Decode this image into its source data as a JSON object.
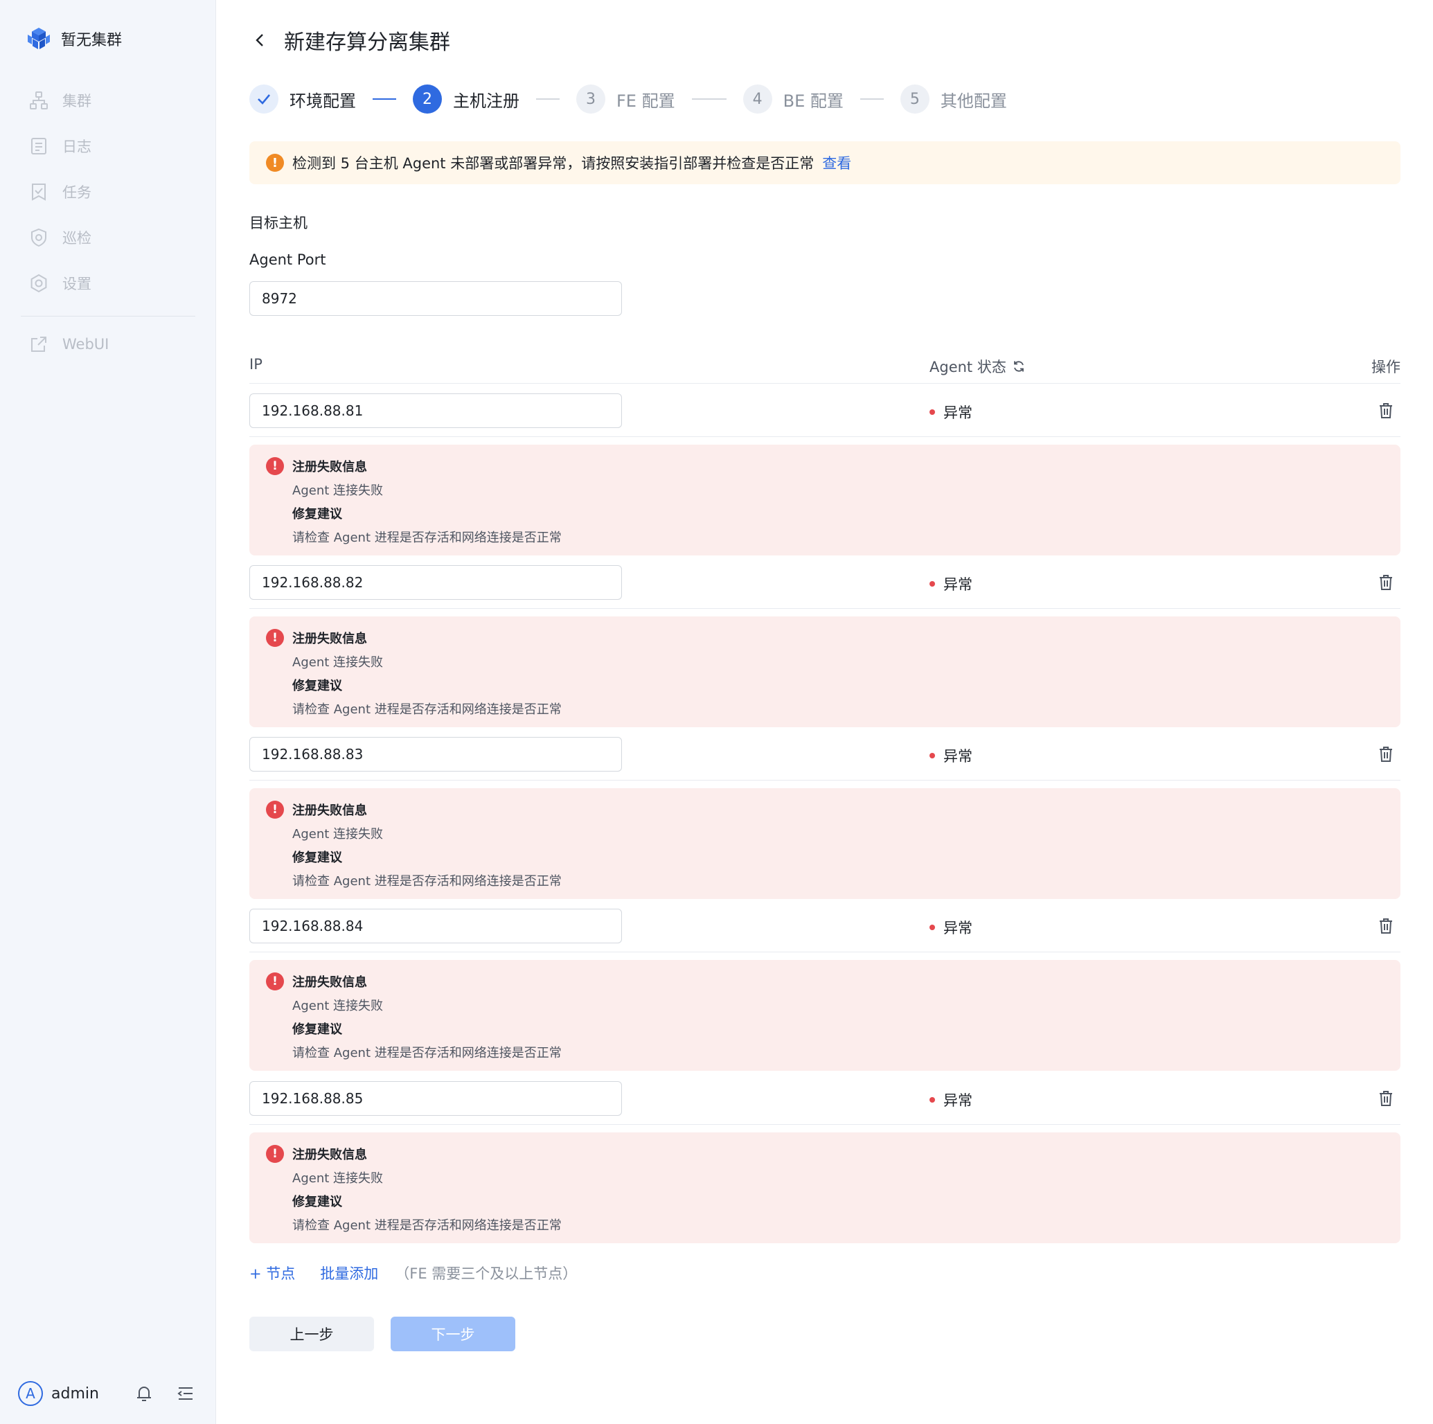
{
  "sidebar": {
    "brand": "暂无集群",
    "items": [
      {
        "label": "集群",
        "icon": "cluster-icon"
      },
      {
        "label": "日志",
        "icon": "log-icon"
      },
      {
        "label": "任务",
        "icon": "task-icon"
      },
      {
        "label": "巡检",
        "icon": "inspect-icon"
      },
      {
        "label": "设置",
        "icon": "settings-icon"
      }
    ],
    "webui": {
      "label": "WebUI",
      "icon": "external-link-icon"
    },
    "user": {
      "avatar_letter": "A",
      "name": "admin"
    }
  },
  "header": {
    "title": "新建存算分离集群"
  },
  "steps": [
    {
      "number": "",
      "label": "环境配置",
      "state": "done"
    },
    {
      "number": "2",
      "label": "主机注册",
      "state": "active"
    },
    {
      "number": "3",
      "label": "FE 配置",
      "state": "todo"
    },
    {
      "number": "4",
      "label": "BE 配置",
      "state": "todo"
    },
    {
      "number": "5",
      "label": "其他配置",
      "state": "todo"
    }
  ],
  "alert": {
    "icon": "!",
    "text": "检测到 5 台主机 Agent 未部署或部署异常，请按照安装指引部署并检查是否正常",
    "link": "查看"
  },
  "form": {
    "section_label": "目标主机",
    "port_label": "Agent Port",
    "port_value": "8972"
  },
  "table": {
    "col_ip": "IP",
    "col_status": "Agent 状态",
    "col_op": "操作",
    "rows": [
      {
        "ip": "192.168.88.81",
        "status": "异常"
      },
      {
        "ip": "192.168.88.82",
        "status": "异常"
      },
      {
        "ip": "192.168.88.83",
        "status": "异常"
      },
      {
        "ip": "192.168.88.84",
        "status": "异常"
      },
      {
        "ip": "192.168.88.85",
        "status": "异常"
      }
    ],
    "error": {
      "title": "注册失败信息",
      "message": "Agent 连接失败",
      "fix_title": "修复建议",
      "fix_message": "请检查 Agent 进程是否存活和网络连接是否正常"
    }
  },
  "actions": {
    "add_node": "+ 节点",
    "batch_add": "批量添加",
    "hint": "（FE 需要三个及以上节点）",
    "prev": "上一步",
    "next": "下一步"
  },
  "colors": {
    "accent": "#2f6ae0",
    "danger": "#e5484d",
    "warning": "#f08a24"
  }
}
